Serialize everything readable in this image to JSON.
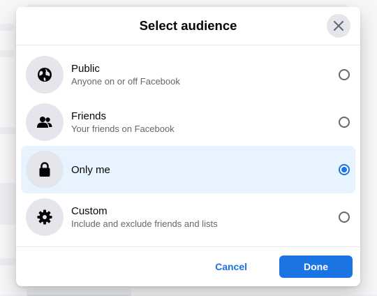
{
  "modal": {
    "title": "Select audience",
    "close_icon": "close-icon"
  },
  "options": [
    {
      "label": "Public",
      "description": "Anyone on or off Facebook",
      "icon": "globe-icon",
      "selected": false
    },
    {
      "label": "Friends",
      "description": "Your friends on Facebook",
      "icon": "friends-icon",
      "selected": false
    },
    {
      "label": "Only me",
      "description": "",
      "icon": "lock-icon",
      "selected": true
    },
    {
      "label": "Custom",
      "description": "Include and exclude friends and lists",
      "icon": "gear-icon",
      "selected": false
    }
  ],
  "footer": {
    "cancel_label": "Cancel",
    "done_label": "Done"
  },
  "colors": {
    "accent": "#1b74e4",
    "selected_bg": "#e7f3ff",
    "icon_bg": "#e4e6eb"
  }
}
